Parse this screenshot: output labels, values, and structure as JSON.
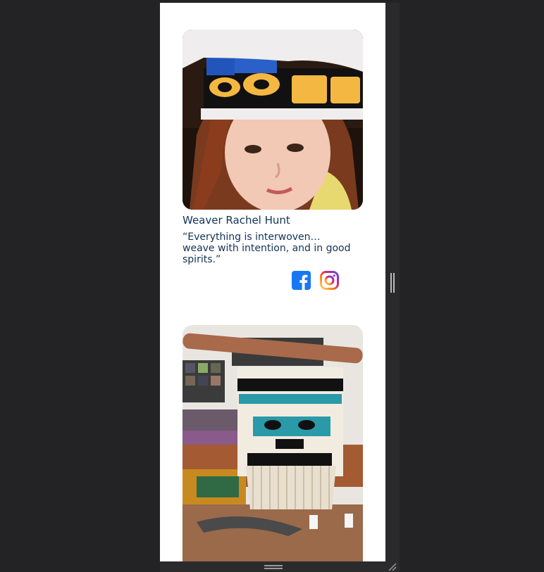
{
  "weaver": {
    "name": "Weaver Rachel Hunt",
    "quote": "“Everything is interwoven… weave with intention, and in good spirits.”"
  },
  "images": {
    "portrait_alt": "",
    "weaving_alt": ""
  },
  "social": {
    "facebook_icon": "facebook-icon",
    "instagram_icon": "instagram-icon"
  },
  "colors": {
    "text": "#113355",
    "facebook_blue": "#1877F2",
    "page_background": "#232325"
  }
}
